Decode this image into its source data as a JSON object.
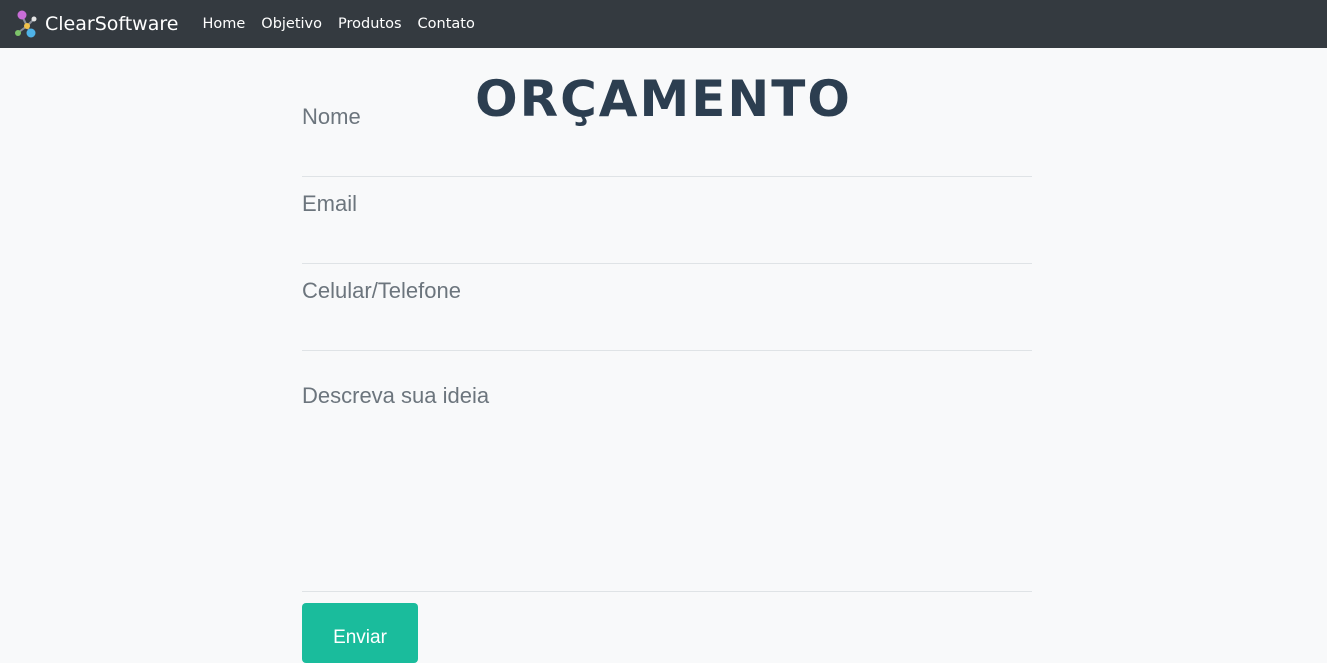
{
  "navbar": {
    "brand_name": "ClearSoftware",
    "brand_icon": "molecule-logo-icon",
    "links": [
      {
        "label": "Home"
      },
      {
        "label": "Objetivo"
      },
      {
        "label": "Produtos"
      },
      {
        "label": "Contato"
      }
    ],
    "background_color": "#343a40"
  },
  "main": {
    "heading": "ORÇAMENTO",
    "form": {
      "name_placeholder": "Nome",
      "email_placeholder": "Email",
      "phone_placeholder": "Celular/Telefone",
      "description_placeholder": "Descreva sua ideia",
      "submit_label": "Enviar"
    },
    "accent_color": "#1abc9c",
    "heading_color": "#2c3e50"
  }
}
